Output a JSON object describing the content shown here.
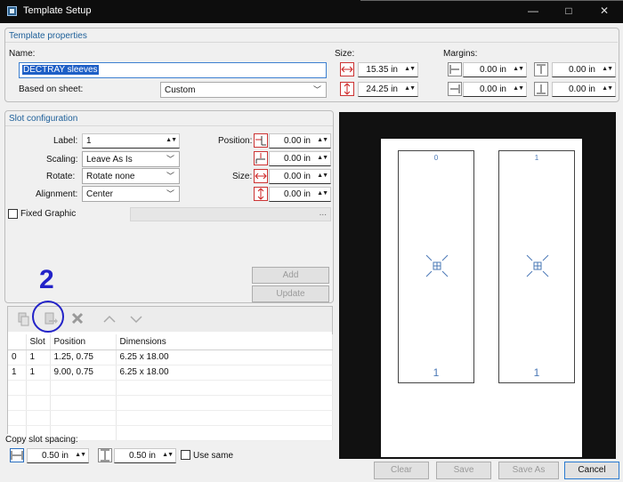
{
  "window": {
    "title": "Template Setup",
    "controls": {
      "minimize": "—",
      "maximize": "□",
      "close": "✕"
    }
  },
  "template_properties": {
    "heading": "Template properties",
    "name_label": "Name:",
    "name_value": "DECTRAY sleeves",
    "based_on_label": "Based on sheet:",
    "based_on_value": "Custom",
    "size_label": "Size:",
    "width": "15.35 in",
    "height": "24.25 in",
    "margins_label": "Margins:",
    "margin_left": "0.00 in",
    "margin_top": "0.00 in",
    "margin_right": "0.00 in",
    "margin_bottom": "0.00 in"
  },
  "slot_configuration": {
    "heading": "Slot configuration",
    "label_label": "Label:",
    "label_value": "1",
    "scaling_label": "Scaling:",
    "scaling_value": "Leave As Is",
    "rotate_label": "Rotate:",
    "rotate_value": "Rotate none",
    "alignment_label": "Alignment:",
    "alignment_value": "Center",
    "position_label": "Position:",
    "pos_x": "0.00 in",
    "pos_y": "0.00 in",
    "size_label": "Size:",
    "size_w": "0.00 in",
    "size_h": "0.00 in",
    "fixed_graphic_label": "Fixed Graphic",
    "fixed_graphic_browse": "...",
    "add_button": "Add",
    "update_button": "Update"
  },
  "annotation": {
    "number": "2"
  },
  "slot_table": {
    "columns": [
      "",
      "Slot",
      "Position",
      "Dimensions"
    ],
    "rows": [
      [
        "0",
        "1",
        "1.25, 0.75",
        "6.25 x 18.00"
      ],
      [
        "1",
        "1",
        "9.00, 0.75",
        "6.25 x 18.00"
      ]
    ]
  },
  "spacing": {
    "label": "Copy slot spacing:",
    "horizontal": "0.50 in",
    "vertical": "0.50 in",
    "use_same_label": "Use same"
  },
  "preview": {
    "slots": [
      {
        "index": "0",
        "label": "1"
      },
      {
        "index": "1",
        "label": "1"
      }
    ]
  },
  "footer": {
    "clear": "Clear",
    "save": "Save",
    "save_as": "Save As",
    "cancel": "Cancel"
  },
  "colors": {
    "accent": "#1d5f99",
    "annotation": "#2323c8",
    "selection": "#1e5fc6"
  }
}
